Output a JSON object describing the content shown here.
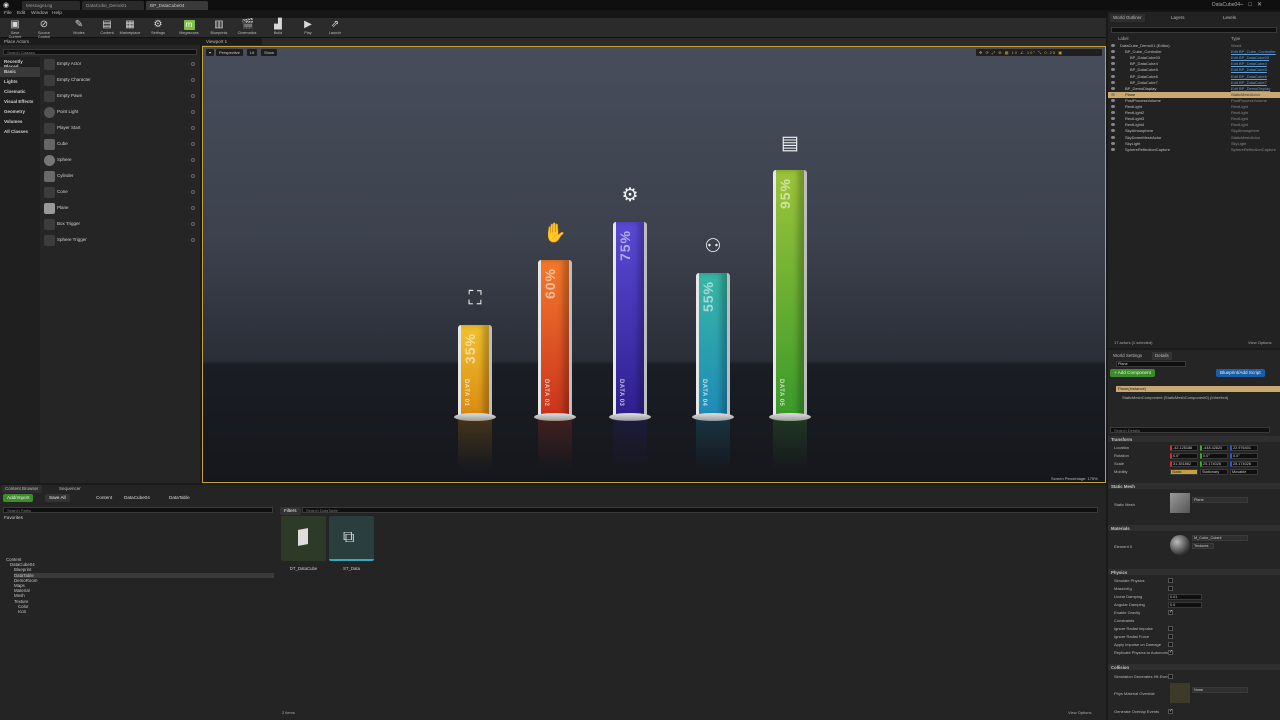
{
  "window": {
    "tabs": [
      "MessageLog",
      "DataCube_Demo01",
      "BP_DataCube04"
    ],
    "project_name": "DataCube04",
    "menu": [
      "File",
      "Edit",
      "Window",
      "Help"
    ]
  },
  "toolbar": {
    "buttons": [
      {
        "label": "Save Current",
        "icon": "save-icon"
      },
      {
        "label": "Source Control",
        "icon": "source-control-icon"
      },
      {
        "label": "Modes",
        "icon": "modes-icon"
      },
      {
        "label": "Content",
        "icon": "content-icon"
      },
      {
        "label": "Marketplace",
        "icon": "marketplace-icon"
      },
      {
        "label": "Settings",
        "icon": "gear-icon"
      },
      {
        "label": "Megascans",
        "icon": "megascans-icon"
      },
      {
        "label": "Blueprints",
        "icon": "blueprints-icon"
      },
      {
        "label": "Cinematics",
        "icon": "cinematics-icon"
      },
      {
        "label": "Build",
        "icon": "build-icon"
      },
      {
        "label": "Play",
        "icon": "play-icon"
      },
      {
        "label": "Launch",
        "icon": "launch-icon"
      }
    ]
  },
  "place_panel": {
    "tab": "Place Actors",
    "search_placeholder": "Search Classes",
    "categories": [
      "Recently Placed",
      "Basic",
      "Lights",
      "Cinematic",
      "Visual Effects",
      "Geometry",
      "Volumes",
      "All Classes"
    ],
    "items": [
      "Empty Actor",
      "Empty Character",
      "Empty Pawn",
      "Point Light",
      "Player Start",
      "Cube",
      "Sphere",
      "Cylinder",
      "Cone",
      "Plane",
      "Box Trigger",
      "Sphere Trigger"
    ]
  },
  "viewport": {
    "tab": "Viewport 1",
    "mode_buttons": [
      "Perspective",
      "Lit",
      "Show"
    ],
    "screen_percentage": "Screen Percentage: 175%",
    "bars": [
      {
        "label": "DATA 01",
        "percent": "35%",
        "value": 35,
        "color_top": "#f2c22e",
        "color_bot": "#d98a12",
        "icon": "presentation-icon"
      },
      {
        "label": "DATA 02",
        "percent": "60%",
        "value": 60,
        "color_top": "#f47a2a",
        "color_bot": "#c9331e",
        "icon": "raised-hands-icon"
      },
      {
        "label": "DATA 03",
        "percent": "75%",
        "value": 75,
        "color_top": "#5a4ad6",
        "color_bot": "#2e1f8e",
        "icon": "head-gears-icon"
      },
      {
        "label": "DATA 04",
        "percent": "55%",
        "value": 55,
        "color_top": "#38b7a4",
        "color_bot": "#1e8ab8",
        "icon": "team-icon"
      },
      {
        "label": "DATA 05",
        "percent": "95%",
        "value": 95,
        "color_top": "#9cc43a",
        "color_bot": "#3a9a2a",
        "icon": "board-icon"
      }
    ]
  },
  "outliner": {
    "tabs": [
      "World Outliner",
      "Layers",
      "Levels"
    ],
    "col_label": "Label",
    "col_type": "Type",
    "rows": [
      {
        "name": "DataCube_Demo01 (Editor)",
        "type": "World",
        "indent": 0,
        "link": false,
        "sel": false
      },
      {
        "name": "BP_Cube_Controller",
        "type": "Edit BP_Cube_Controller",
        "indent": 1,
        "link": true,
        "sel": false
      },
      {
        "name": "BP_DataCube03",
        "type": "Edit BP_DataCube03",
        "indent": 2,
        "link": true,
        "sel": false
      },
      {
        "name": "BP_DataCube4",
        "type": "Edit BP_DataCube4",
        "indent": 2,
        "link": true,
        "sel": false
      },
      {
        "name": "BP_DataCube5",
        "type": "Edit BP_DataCube5",
        "indent": 2,
        "link": true,
        "sel": false
      },
      {
        "name": "BP_DataCube6",
        "type": "Edit BP_DataCube6",
        "indent": 2,
        "link": true,
        "sel": false
      },
      {
        "name": "BP_DataCube7",
        "type": "Edit BP_DataCube7",
        "indent": 2,
        "link": true,
        "sel": false
      },
      {
        "name": "BP_DemoDisplay",
        "type": "Edit BP_DemoDisplay",
        "indent": 1,
        "link": true,
        "sel": false
      },
      {
        "name": "Plane",
        "type": "StaticMeshActor",
        "indent": 1,
        "link": false,
        "sel": true
      },
      {
        "name": "PostProcessVolume",
        "type": "PostProcessVolume",
        "indent": 1,
        "link": false,
        "sel": false
      },
      {
        "name": "RectLight",
        "type": "RectLight",
        "indent": 1,
        "link": false,
        "sel": false
      },
      {
        "name": "RectLight2",
        "type": "RectLight",
        "indent": 1,
        "link": false,
        "sel": false
      },
      {
        "name": "RectLight3",
        "type": "RectLight",
        "indent": 1,
        "link": false,
        "sel": false
      },
      {
        "name": "RectLight4",
        "type": "RectLight",
        "indent": 1,
        "link": false,
        "sel": false
      },
      {
        "name": "SkyAtmosphere",
        "type": "SkyAtmosphere",
        "indent": 1,
        "link": false,
        "sel": false
      },
      {
        "name": "SkyDomeMeshActor",
        "type": "StaticMeshActor",
        "indent": 1,
        "link": false,
        "sel": false
      },
      {
        "name": "SkyLight",
        "type": "SkyLight",
        "indent": 1,
        "link": false,
        "sel": false
      },
      {
        "name": "SphereReflectionCapture",
        "type": "SphereReflectionCapture",
        "indent": 1,
        "link": false,
        "sel": false
      }
    ],
    "footer": "17 actors (1 selected)",
    "view_options": "View Options"
  },
  "details": {
    "tabs": [
      "World Settings",
      "Details"
    ],
    "name_value": "Plane",
    "add_component": "+ Add Component",
    "blueprint_btn": "Blueprint/Add Script",
    "instance": "Plane(Instance)",
    "component": "StaticMeshComponent (StaticMeshComponent0) (Inherited)",
    "search_placeholder": "Search Details",
    "transform_header": "Transform",
    "location_label": "Location",
    "rotation_label": "Rotation",
    "scale_label": "Scale",
    "mobility_label": "Mobility",
    "location": [
      "-42.125186",
      "-448.42820",
      "22.976401"
    ],
    "rotation": [
      "0.0°",
      "0.0°",
      "0.0°"
    ],
    "scale": [
      "31.351862",
      "25.174026",
      "25.174026"
    ],
    "mobility": [
      "Static",
      "Stationary",
      "Movable"
    ],
    "static_mesh_header": "Static Mesh",
    "static_mesh_label": "Static Mesh",
    "static_mesh_value": "Plane",
    "materials_header": "Materials",
    "element_label": "Element 0",
    "material_value": "M_Color_Cube4",
    "material_sub": "Textures",
    "physics_header": "Physics",
    "physics_rows": [
      {
        "label": "Simulate Physics",
        "checked": false
      },
      {
        "label": "MassInKg",
        "checked": false
      },
      {
        "label": "Linear Damping",
        "checked": false
      },
      {
        "label": "Angular Damping",
        "checked": false
      },
      {
        "label": "Enable Gravity",
        "checked": true
      },
      {
        "label": "Constraints",
        "checked": false
      },
      {
        "label": "Ignore Radial Impulse",
        "checked": false
      },
      {
        "label": "Ignore Radial Force",
        "checked": false
      },
      {
        "label": "Apply Impulse on Damage",
        "checked": false
      },
      {
        "label": "Replicate Physics to Autonomous",
        "checked": true
      }
    ],
    "linear_damping": "0.01",
    "angular_damping": "0.0",
    "collision_header": "Collision",
    "collision_rows": [
      "Simulation Generates Hit Events",
      "Phys Material Override",
      "Generate Overlap Events"
    ],
    "phys_material": "None"
  },
  "content_browser": {
    "tabs": [
      "Content Browser",
      "Sequencer"
    ],
    "add_import": "Add/Import",
    "save_all": "Save All",
    "path": [
      "Content",
      "DataCube04",
      "DataTable"
    ],
    "search_paths": "Search Paths",
    "favorites": "Favorites",
    "filters": "Filters",
    "search_placeholder": "Search DataTable",
    "tree": [
      "Content",
      "DataCube04",
      "Blueprint",
      "DataTable",
      "DemoRoom",
      "Maps",
      "Material",
      "Mesh",
      "Texture",
      "Color",
      "Icon"
    ],
    "assets": [
      "DT_DataCube",
      "ST_Data"
    ],
    "item_count": "2 items",
    "view_options": "View Options"
  }
}
